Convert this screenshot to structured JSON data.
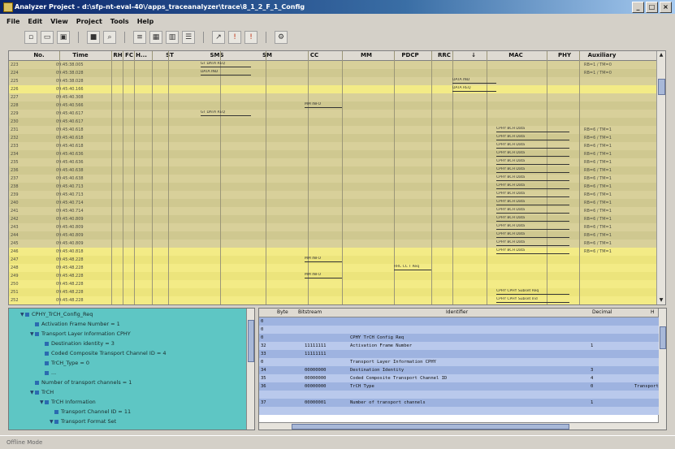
{
  "window": {
    "title": "Analyzer Project - d:\\sfp-nt-eval-40\\/apps_traceanalyzer\\trace\\8_1_2_F_1_Config",
    "min_label": "_",
    "max_label": "□",
    "close_label": "×"
  },
  "menu": [
    {
      "label": "File"
    },
    {
      "label": "Edit"
    },
    {
      "label": "View"
    },
    {
      "label": "Project"
    },
    {
      "label": "Tools"
    },
    {
      "label": "Help"
    }
  ],
  "toolbar": [
    {
      "icon": "new-doc-icon",
      "glyph": "▫"
    },
    {
      "icon": "open-icon",
      "glyph": "▭"
    },
    {
      "icon": "save-icon",
      "glyph": "▣"
    },
    {
      "icon": "find-icon",
      "glyph": "■"
    },
    {
      "icon": "zoom-icon",
      "glyph": "⌕"
    },
    {
      "icon": "filter-icon",
      "glyph": "≡"
    },
    {
      "icon": "grid-icon",
      "glyph": "▦"
    },
    {
      "icon": "columns-icon",
      "glyph": "▥"
    },
    {
      "icon": "list-icon",
      "glyph": "☰"
    },
    {
      "icon": "arrow-icon",
      "glyph": "↗"
    },
    {
      "icon": "run-icon",
      "glyph": "!"
    },
    {
      "icon": "stop-icon",
      "glyph": "!"
    },
    {
      "icon": "settings-icon",
      "glyph": "⚙"
    }
  ],
  "columns": [
    "No.",
    "Time",
    "RH",
    "FC",
    "H...",
    "ST",
    "SMS",
    "SM",
    "CC",
    "MM",
    "PDCP",
    "RRC",
    "↓",
    "MAC",
    "PHY",
    "Auxiliary"
  ],
  "rows": [
    {
      "no": "223",
      "time": "09:45:38.005",
      "style": "y1"
    },
    {
      "no": "224",
      "time": "09:45:38.028",
      "style": "y2"
    },
    {
      "no": "225",
      "time": "09:45:38.028",
      "style": "y1"
    },
    {
      "no": "226",
      "time": "09:45:40.166",
      "style": "hl"
    },
    {
      "no": "227",
      "time": "09:45:40.308",
      "style": "y1"
    },
    {
      "no": "228",
      "time": "09:45:40.566",
      "style": "y2"
    },
    {
      "no": "229",
      "time": "09:45:40.617",
      "style": "y1"
    },
    {
      "no": "230",
      "time": "09:45:40.617",
      "style": "y2"
    },
    {
      "no": "231",
      "time": "09:45:40.618",
      "style": "y1"
    },
    {
      "no": "232",
      "time": "09:45:40.618",
      "style": "y2"
    },
    {
      "no": "233",
      "time": "09:45:40.618",
      "style": "y1"
    },
    {
      "no": "234",
      "time": "09:45:40.636",
      "style": "y2"
    },
    {
      "no": "235",
      "time": "09:45:40.636",
      "style": "y1"
    },
    {
      "no": "236",
      "time": "09:45:40.638",
      "style": "y2"
    },
    {
      "no": "237",
      "time": "09:45:40.638",
      "style": "y1"
    },
    {
      "no": "238",
      "time": "09:45:40.713",
      "style": "y2"
    },
    {
      "no": "239",
      "time": "09:45:40.713",
      "style": "y1"
    },
    {
      "no": "240",
      "time": "09:45:40.714",
      "style": "y2"
    },
    {
      "no": "241",
      "time": "09:45:40.714",
      "style": "y1"
    },
    {
      "no": "242",
      "time": "09:45:40.809",
      "style": "y2"
    },
    {
      "no": "243",
      "time": "09:45:40.809",
      "style": "y1"
    },
    {
      "no": "244",
      "time": "09:45:40.809",
      "style": "y2"
    },
    {
      "no": "245",
      "time": "09:45:40.809",
      "style": "y1"
    },
    {
      "no": "246",
      "time": "09:45:40.818",
      "style": "hl"
    },
    {
      "no": "247",
      "time": "09:45:48.228",
      "style": "hl2"
    },
    {
      "no": "248",
      "time": "09:45:48.228",
      "style": "hl"
    },
    {
      "no": "249",
      "time": "09:45:48.228",
      "style": "hl2"
    },
    {
      "no": "250",
      "time": "09:45:48.228",
      "style": "hl"
    },
    {
      "no": "251",
      "time": "09:45:48.228",
      "style": "hl2"
    },
    {
      "no": "252",
      "time": "09:45:48.228",
      "style": "hl"
    }
  ],
  "messages": [
    {
      "row": 0,
      "label": "GT DATA REQ",
      "from": 6,
      "to": 7
    },
    {
      "row": 1,
      "label": "DATA IND",
      "from": 6,
      "to": 7
    },
    {
      "row": 2,
      "label": "DATA IND",
      "from": 13,
      "to": 14
    },
    {
      "row": 3,
      "label": "DATA REQ",
      "from": 13,
      "to": 14
    },
    {
      "row": 5,
      "label": "MM INFO",
      "from": 9,
      "to": 10
    },
    {
      "row": 6,
      "label": "GT DATA REQ",
      "from": 6,
      "to": 7
    },
    {
      "row": 8,
      "label": "CPHY BCH Data",
      "from": 14,
      "to": 15
    },
    {
      "row": 9,
      "label": "CPHY BCH Data",
      "from": 14,
      "to": 15
    },
    {
      "row": 10,
      "label": "CPHY BCH Data",
      "from": 14,
      "to": 15
    },
    {
      "row": 11,
      "label": "CPHY BCH Data",
      "from": 14,
      "to": 15
    },
    {
      "row": 12,
      "label": "CPHY BCH Data",
      "from": 14,
      "to": 15
    },
    {
      "row": 13,
      "label": "CPHY BCH Data",
      "from": 14,
      "to": 15
    },
    {
      "row": 14,
      "label": "CPHY BCH Data",
      "from": 14,
      "to": 15
    },
    {
      "row": 15,
      "label": "CPHY BCH Data",
      "from": 14,
      "to": 15
    },
    {
      "row": 16,
      "label": "CPHY BCH Data",
      "from": 14,
      "to": 15
    },
    {
      "row": 17,
      "label": "CPHY BCH Data",
      "from": 14,
      "to": 15
    },
    {
      "row": 18,
      "label": "CPHY BCH Data",
      "from": 14,
      "to": 15
    },
    {
      "row": 19,
      "label": "CPHY BCH Data",
      "from": 14,
      "to": 15
    },
    {
      "row": 20,
      "label": "CPHY BCH Data",
      "from": 14,
      "to": 15
    },
    {
      "row": 21,
      "label": "CPHY BCH Data",
      "from": 14,
      "to": 15
    },
    {
      "row": 22,
      "label": "CPHY BCH Data",
      "from": 14,
      "to": 15
    },
    {
      "row": 23,
      "label": "CPHY BCH Data",
      "from": 14,
      "to": 15
    },
    {
      "row": 24,
      "label": "MM INFO",
      "from": 9,
      "to": 10
    },
    {
      "row": 25,
      "label": "RRC CC T Req",
      "from": 11,
      "to": 12
    },
    {
      "row": 26,
      "label": "MM INFO",
      "from": 9,
      "to": 10
    },
    {
      "row": 28,
      "label": "CPHY CPHY Subset Req",
      "from": 14,
      "to": 15
    },
    {
      "row": 29,
      "label": "CPHY CPHY Subset Ind",
      "from": 14,
      "to": 15
    }
  ],
  "aux": [
    "RB=1 / TM=0",
    "RB=1 / TM=0",
    "",
    "",
    "",
    "",
    "",
    "",
    "RB=6 / TM=1",
    "RB=6 / TM=1",
    "RB=6 / TM=1",
    "RB=6 / TM=1",
    "RB=6 / TM=1",
    "RB=6 / TM=1",
    "RB=6 / TM=1",
    "RB=6 / TM=1",
    "RB=6 / TM=1",
    "RB=6 / TM=1",
    "RB=6 / TM=1",
    "RB=6 / TM=1",
    "RB=6 / TM=1",
    "RB=6 / TM=1",
    "RB=6 / TM=1",
    "RB=6 / TM=1"
  ],
  "tree": [
    {
      "label": "CPHY_TrCH_Config_Req",
      "depth": 0,
      "exp": "▼"
    },
    {
      "label": "Activation Frame Number = 1",
      "depth": 1,
      "exp": ""
    },
    {
      "label": "Transport Layer Information CPHY",
      "depth": 1,
      "exp": "▼"
    },
    {
      "label": "Destination identity = 3",
      "depth": 2,
      "exp": ""
    },
    {
      "label": "Coded Composite Transport Channel ID = 4",
      "depth": 2,
      "exp": ""
    },
    {
      "label": "TrCH_Type = 0",
      "depth": 2,
      "exp": ""
    },
    {
      "label": "...",
      "depth": 2,
      "exp": ""
    },
    {
      "label": "Number of transport channels = 1",
      "depth": 1,
      "exp": ""
    },
    {
      "label": "TrCH",
      "depth": 1,
      "exp": "▼"
    },
    {
      "label": "TrCH Information",
      "depth": 2,
      "exp": "▼"
    },
    {
      "label": "Transport Channel ID = 11",
      "depth": 3,
      "exp": ""
    },
    {
      "label": "Transport Format Set",
      "depth": 3,
      "exp": "▼"
    }
  ],
  "grid": {
    "headers": [
      "Byte",
      "Bitstream",
      "Identifier",
      "Decimal",
      "H"
    ],
    "rows": [
      {
        "byte": "0",
        "bits": "",
        "ident": "",
        "dec": "",
        "style": "b1"
      },
      {
        "byte": "0",
        "bits": "",
        "ident": "",
        "dec": "",
        "style": "b2"
      },
      {
        "byte": "0",
        "bits": "",
        "ident": "CPHY TrCH Config Req",
        "dec": "",
        "style": "b1"
      },
      {
        "byte": "32",
        "bits": "11111111",
        "ident": "Activation Frame Number",
        "dec": "1",
        "style": "b2"
      },
      {
        "byte": "33",
        "bits": "11111111",
        "ident": "",
        "dec": "",
        "style": "b1"
      },
      {
        "byte": "0",
        "bits": "",
        "ident": "Transport Layer Information CPHY",
        "dec": "",
        "style": "b2"
      },
      {
        "byte": "34",
        "bits": "00000000",
        "ident": "Destination Identity",
        "dec": "3",
        "style": "b1"
      },
      {
        "byte": "35",
        "bits": "00000000",
        "ident": "Coded Composite Transport Channel ID",
        "dec": "4",
        "style": "b2"
      },
      {
        "byte": "36",
        "bits": "00000000",
        "ident": "TrCH Type",
        "dec": "0",
        "hex": "Transport",
        "style": "b1"
      },
      {
        "byte": "",
        "bits": "",
        "ident": "",
        "dec": "",
        "style": "b2"
      },
      {
        "byte": "37",
        "bits": "00000001",
        "ident": "Number of transport channels",
        "dec": "1",
        "style": "b1"
      },
      {
        "byte": "",
        "bits": "",
        "ident": "",
        "dec": "",
        "style": "b2"
      }
    ]
  },
  "status": "Offline Mode"
}
